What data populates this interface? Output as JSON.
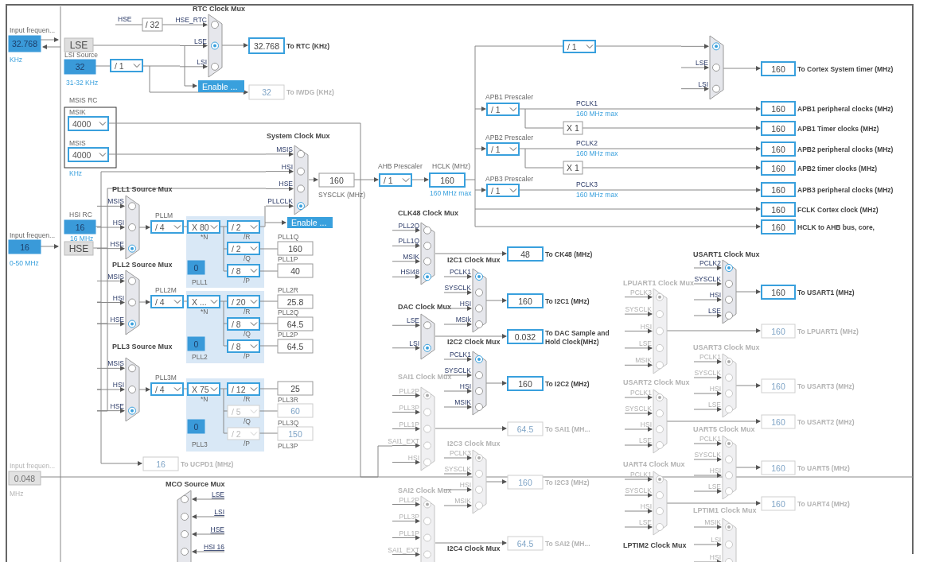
{
  "muxes": [
    {
      "title": "RTC Clock Mux",
      "enabled": true,
      "inputs": [
        {
          "label": "HSE_RTC",
          "selected": false
        },
        {
          "label": "LSE",
          "selected": true
        },
        {
          "label": "LSI",
          "selected": false
        }
      ]
    },
    {
      "enabled": true,
      "inputs": [
        {
          "selected": true
        },
        {
          "label": "LSE",
          "selected": false
        },
        {
          "label": "LSI",
          "selected": false
        }
      ]
    },
    {
      "title": "PLL1 Source Mux",
      "enabled": true,
      "inputs": [
        {
          "label": "MSIS",
          "selected": false
        },
        {
          "label": "HSI",
          "selected": false
        },
        {
          "label": "HSE",
          "selected": true
        }
      ]
    },
    {
      "title": "System Clock Mux",
      "enabled": true,
      "inputs": [
        {
          "label": "MSIS",
          "selected": false
        },
        {
          "label": "HSI",
          "selected": false
        },
        {
          "label": "HSE",
          "selected": false
        },
        {
          "label": "PLLCLK",
          "selected": true
        }
      ]
    },
    {
      "title": "PLL2 Source Mux",
      "enabled": true,
      "inputs": [
        {
          "label": "MSIS",
          "selected": false
        },
        {
          "label": "HSI",
          "selected": false
        },
        {
          "label": "HSE",
          "selected": true
        }
      ]
    },
    {
      "title": "PLL3 Source Mux",
      "enabled": true,
      "inputs": [
        {
          "label": "MSIS",
          "selected": false
        },
        {
          "label": "HSI",
          "selected": false
        },
        {
          "label": "HSE",
          "selected": true
        }
      ]
    },
    {
      "title": "CLK48 Clock Mux",
      "enabled": true,
      "inputs": [
        {
          "label": "PLL2Q",
          "selected": false
        },
        {
          "label": "PLL1Q",
          "selected": false
        },
        {
          "label": "MSIK",
          "selected": false
        },
        {
          "label": "HSI48",
          "selected": true
        }
      ]
    },
    {
      "title": "DAC Clock Mux",
      "enabled": true,
      "inputs": [
        {
          "label": "LSE",
          "selected": false
        },
        {
          "label": "LSI",
          "selected": true
        }
      ]
    },
    {
      "title": "I2C1 Clock Mux",
      "enabled": true,
      "inputs": [
        {
          "label": "PCLK1",
          "selected": true
        },
        {
          "label": "SYSCLK",
          "selected": false
        },
        {
          "label": "HSI",
          "selected": false
        },
        {
          "label": "MSIk",
          "selected": false
        }
      ]
    },
    {
      "title": "SAI1 Clock Mux",
      "enabled": false,
      "inputs": [
        {
          "label": "PLL2P",
          "selected": true
        },
        {
          "label": "PLL3P",
          "selected": false
        },
        {
          "label": "PLL1P",
          "selected": false
        },
        {
          "label": "SAI1_EXT",
          "selected": false
        },
        {
          "label": "HSI",
          "selected": false
        }
      ]
    },
    {
      "title": "I2C2 Clock Mux",
      "enabled": true,
      "inputs": [
        {
          "label": "PCLK1",
          "selected": true
        },
        {
          "label": "SYSCLK",
          "selected": false
        },
        {
          "label": "HSI",
          "selected": false
        },
        {
          "label": "MSIK",
          "selected": false
        }
      ]
    },
    {
      "title": "MCO Source Mux",
      "enabled": true,
      "inputs": [
        {
          "label": "LSE",
          "selected": false
        },
        {
          "label": "LSI",
          "selected": false
        },
        {
          "label": "HSE",
          "selected": false
        },
        {
          "label": "HSI 16",
          "selected": false
        }
      ]
    },
    {
      "title": "SAI2 Clock Mux",
      "enabled": false,
      "inputs": [
        {
          "label": "PLL2P",
          "selected": true
        },
        {
          "label": "PLL3P",
          "selected": false
        },
        {
          "label": "PLL1P",
          "selected": false
        },
        {
          "label": "SAI1_EXT",
          "selected": false
        }
      ]
    },
    {
      "title": "I2C3 Clock Mux",
      "enabled": false,
      "inputs": [
        {
          "label": "PCLK3",
          "selected": true
        },
        {
          "label": "SYSCLK",
          "selected": false
        },
        {
          "label": "HSI",
          "selected": false
        },
        {
          "label": "MSIK",
          "selected": false
        }
      ]
    },
    {
      "title": "I2C4 Clock Mux",
      "enabled": true
    },
    {
      "title": "LPUART1 Clock Mux",
      "enabled": false,
      "inputs": [
        {
          "label": "PCLK3",
          "selected": true
        },
        {
          "label": "SYSCLK",
          "selected": false
        },
        {
          "label": "HSI",
          "selected": false
        },
        {
          "label": "LSE",
          "selected": false
        },
        {
          "label": "MSIK",
          "selected": false
        }
      ]
    },
    {
      "title": "USART1 Clock Mux",
      "enabled": true,
      "inputs": [
        {
          "label": "PCLK2",
          "selected": true
        },
        {
          "label": "SYSCLK",
          "selected": false
        },
        {
          "label": "HSI",
          "selected": false
        },
        {
          "label": "LSE",
          "selected": false
        }
      ]
    },
    {
      "title": "USART2 Clock Mux",
      "enabled": false,
      "inputs": [
        {
          "label": "PCLK1",
          "selected": true
        },
        {
          "label": "SYSCLK",
          "selected": false
        },
        {
          "label": "HSI",
          "selected": false
        },
        {
          "label": "LSE",
          "selected": false
        }
      ]
    },
    {
      "title": "USART3 Clock Mux",
      "enabled": false,
      "inputs": [
        {
          "label": "PCLK1",
          "selected": true
        },
        {
          "label": "SYSCLK",
          "selected": false
        },
        {
          "label": "HSI",
          "selected": false
        },
        {
          "label": "LSE",
          "selected": false
        }
      ]
    },
    {
      "title": "UART4 Clock Mux",
      "enabled": false,
      "inputs": [
        {
          "label": "PCLK1",
          "selected": true
        },
        {
          "label": "SYSCLK",
          "selected": false
        },
        {
          "label": "HSI",
          "selected": false
        },
        {
          "label": "LSE",
          "selected": false
        }
      ]
    },
    {
      "title": "UART5 Clock Mux",
      "enabled": false,
      "inputs": [
        {
          "label": "PCLK1",
          "selected": true
        },
        {
          "label": "SYSCLK",
          "selected": false
        },
        {
          "label": "HSI",
          "selected": false
        },
        {
          "label": "LSE",
          "selected": false
        }
      ]
    },
    {
      "title": "LPTIM2 Clock Mux",
      "enabled": true
    },
    {
      "title": "LPTIM1 Clock Mux",
      "enabled": false,
      "inputs": [
        {
          "label": "MSIK",
          "selected": true
        },
        {
          "label": "LSI",
          "selected": false
        },
        {
          "label": "HSI",
          "selected": false
        }
      ]
    }
  ],
  "dropdowns": [
    {
      "value": "/ 1",
      "enabled": true
    },
    {
      "value": "4000",
      "enabled": true
    },
    {
      "value": "4000",
      "enabled": true
    },
    {
      "value": "/ 4",
      "enabled": true
    },
    {
      "value": "X 80",
      "enabled": true
    },
    {
      "value": "/ 2",
      "enabled": true
    },
    {
      "value": "/ 2",
      "enabled": true
    },
    {
      "value": "/ 8",
      "enabled": true
    },
    {
      "value": "/ 4",
      "enabled": true
    },
    {
      "value": "X ...",
      "enabled": true
    },
    {
      "value": "/ 20",
      "enabled": true
    },
    {
      "value": "/ 8",
      "enabled": true
    },
    {
      "value": "/ 8",
      "enabled": true
    },
    {
      "value": "/ 4",
      "enabled": true
    },
    {
      "value": "X 75",
      "enabled": true
    },
    {
      "value": "/ 12",
      "enabled": true
    },
    {
      "value": "/ 5",
      "enabled": false
    },
    {
      "value": "/ 2",
      "enabled": false
    },
    {
      "value": "/ 1",
      "enabled": true
    },
    {
      "value": "/ 1",
      "enabled": true
    },
    {
      "value": "/ 1",
      "enabled": true
    },
    {
      "value": "/ 1",
      "enabled": true
    },
    {
      "value": "/ 1",
      "enabled": true
    }
  ],
  "boxes": [
    {
      "kind": "source",
      "value": "32.768",
      "enabled": true
    },
    {
      "kind": "osc",
      "value": "LSE"
    },
    {
      "kind": "source",
      "value": "32",
      "enabled": true
    },
    {
      "kind": "plain",
      "value": "/ 32",
      "enabled": true
    },
    {
      "kind": "output",
      "value": "32.768",
      "enabled": true,
      "label": [
        "To RTC (KHz)"
      ]
    },
    {
      "kind": "output",
      "value": "32",
      "enabled": false,
      "label": [
        "To IWDG (KHz)"
      ]
    },
    {
      "kind": "source",
      "value": "16",
      "enabled": true
    },
    {
      "kind": "source",
      "value": "16",
      "enabled": true
    },
    {
      "kind": "osc",
      "value": "HSE"
    },
    {
      "kind": "plain",
      "value": "160",
      "enabled": true
    },
    {
      "kind": "plain",
      "value": "160",
      "enabled": true
    },
    {
      "kind": "source",
      "value": "0",
      "enabled": true
    },
    {
      "kind": "plain",
      "value": "40",
      "enabled": true
    },
    {
      "kind": "plain",
      "value": "25.8",
      "enabled": true
    },
    {
      "kind": "plain",
      "value": "64.5",
      "enabled": true
    },
    {
      "kind": "source",
      "value": "0",
      "enabled": true
    },
    {
      "kind": "plain",
      "value": "64.5",
      "enabled": true
    },
    {
      "kind": "plain",
      "value": "25",
      "enabled": true
    },
    {
      "kind": "plain",
      "value": "60",
      "enabled": false
    },
    {
      "kind": "source",
      "value": "0",
      "enabled": true
    },
    {
      "kind": "plain",
      "value": "150",
      "enabled": false
    },
    {
      "kind": "plain",
      "value": "16",
      "enabled": false,
      "label": [
        "To UCPD1 (MHz)"
      ]
    },
    {
      "kind": "source",
      "value": "0.048",
      "enabled": false
    },
    {
      "kind": "output",
      "value": "160",
      "enabled": true
    },
    {
      "kind": "plain",
      "value": "X 1",
      "enabled": true
    },
    {
      "kind": "plain",
      "value": "X 1",
      "enabled": true
    },
    {
      "kind": "output",
      "value": "160",
      "enabled": true,
      "label": [
        "To Cortex System timer (MHz)"
      ]
    },
    {
      "kind": "output",
      "value": "160",
      "enabled": true,
      "label": [
        "APB1 peripheral clocks (MHz)"
      ]
    },
    {
      "kind": "output",
      "value": "160",
      "enabled": true,
      "label": [
        "APB1 Timer clocks (MHz)"
      ]
    },
    {
      "kind": "output",
      "value": "160",
      "enabled": true,
      "label": [
        "APB2 peripheral clocks (MHz)"
      ]
    },
    {
      "kind": "output",
      "value": "160",
      "enabled": true,
      "label": [
        "APB2 timer clocks (MHz)"
      ]
    },
    {
      "kind": "output",
      "value": "160",
      "enabled": true,
      "label": [
        "APB3 peripheral clocks (MHz)"
      ]
    },
    {
      "kind": "output",
      "value": "160",
      "enabled": true,
      "label": [
        "FCLK Cortex clock (MHz)"
      ]
    },
    {
      "kind": "output",
      "value": "160",
      "enabled": true,
      "label": [
        "HCLK to AHB bus, core,"
      ]
    },
    {
      "kind": "output",
      "value": "48",
      "enabled": true,
      "label": [
        "To CK48 (MHz)"
      ]
    },
    {
      "kind": "output",
      "value": "160",
      "enabled": true,
      "label": [
        "To I2C1 (MHz)"
      ]
    },
    {
      "kind": "output",
      "value": "0.032",
      "enabled": true,
      "label": [
        "To DAC Sample and",
        "Hold Clock(MHz)"
      ]
    },
    {
      "kind": "output",
      "value": "160",
      "enabled": true,
      "label": [
        "To I2C2 (MHz)"
      ]
    },
    {
      "kind": "output",
      "value": "64.5",
      "enabled": false,
      "label": [
        "To SAI1 (MH..."
      ]
    },
    {
      "kind": "output",
      "value": "160",
      "enabled": false,
      "label": [
        "To I2C3 (MHz)"
      ]
    },
    {
      "kind": "output",
      "value": "64.5",
      "enabled": false,
      "label": [
        "To SAI2 (MH..."
      ]
    },
    {
      "kind": "output",
      "value": "160",
      "enabled": true,
      "label": [
        "To USART1 (MHz)"
      ]
    },
    {
      "kind": "output",
      "value": "160",
      "enabled": false,
      "label": [
        "To LPUART1 (MHz)"
      ]
    },
    {
      "kind": "output",
      "value": "160",
      "enabled": false,
      "label": [
        "To USART3 (MHz)"
      ]
    },
    {
      "kind": "output",
      "value": "160",
      "enabled": false,
      "label": [
        "To USART2 (MHz)"
      ]
    },
    {
      "kind": "output",
      "value": "160",
      "enabled": false,
      "label": [
        "To UART5 (MHz)"
      ]
    },
    {
      "kind": "output",
      "value": "160",
      "enabled": false,
      "label": [
        "To UART4 (MHz)"
      ]
    }
  ],
  "buttons": [
    {
      "label": "Enable ..."
    },
    {
      "label": "Enable ..."
    }
  ],
  "texts": [
    "Input frequen...",
    "KHz",
    "HSE",
    "LSI Source",
    "31-32 KHz",
    "MSIS RC",
    "MSIK",
    "MSIS",
    "KHz",
    "HSI RC",
    "Input frequen...",
    "16 MHz",
    "0-50 MHz",
    "PLLM",
    "PLL1Q",
    "PLL1P",
    "PLL1",
    "PLL2M",
    "PLL2R",
    "PLL2Q",
    "PLL2P",
    "PLL2",
    "PLL3M",
    "PLL3R",
    "PLL3Q",
    "PLL3",
    "PLL3P",
    "*N",
    "/R",
    "/Q",
    "/P",
    "*N",
    "/R",
    "/Q",
    "/P",
    "*N",
    "/R",
    "/Q",
    "/P",
    "SYSCLK (MHz)",
    "Input frequen...",
    "MHz",
    "AHB Prescaler",
    "HCLK (MHz)",
    "160 MHz max",
    "APB1 Prescaler",
    "PCLK1",
    "160 MHz max",
    "APB2 Prescaler",
    "PCLK2",
    "160 MHz max",
    "APB3 Prescaler",
    "PCLK3",
    "160 MHz max"
  ]
}
